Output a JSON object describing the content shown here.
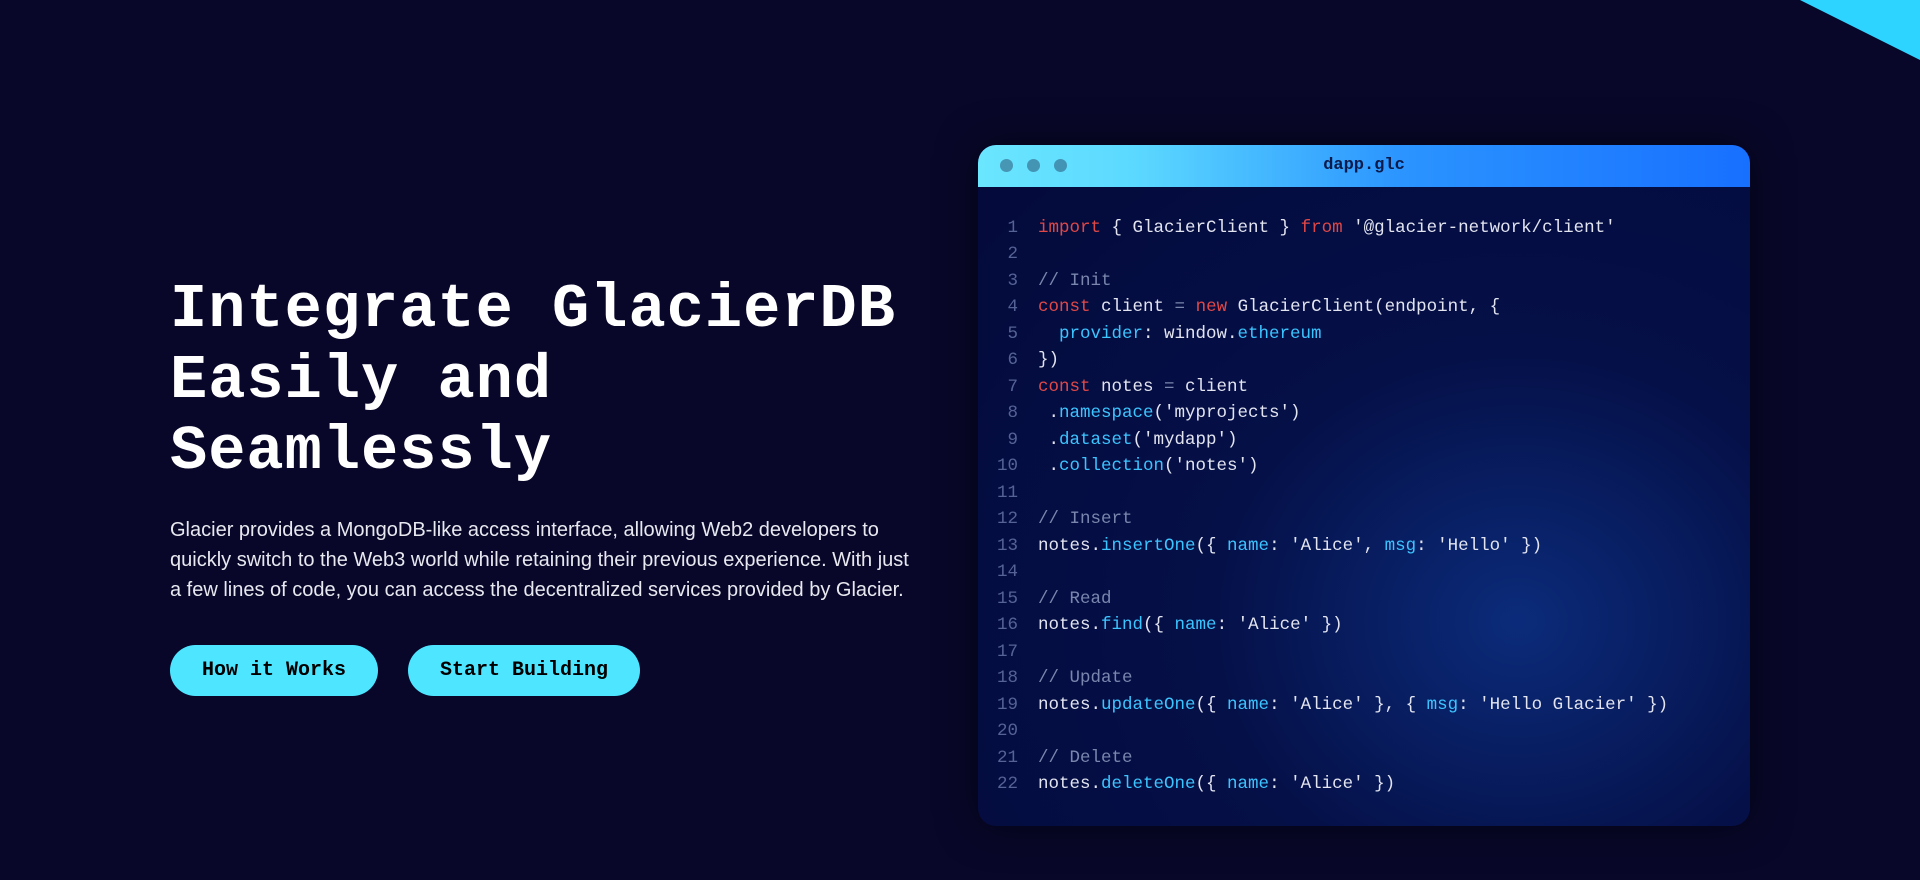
{
  "hero": {
    "heading": "Integrate GlacierDB\nEasily and Seamlessly",
    "description": "Glacier provides a MongoDB-like access interface, allowing Web2 developers to quickly switch to the Web3 world while retaining their previous experience. With just a few lines of code, you can access the decentralized services provided by Glacier.",
    "buttons": {
      "how": "How it Works",
      "start": "Start Building"
    }
  },
  "editor": {
    "filename": "dapp.glc",
    "lines": [
      [
        {
          "t": "key",
          "v": "import"
        },
        {
          "t": "",
          "v": " { GlacierClient } "
        },
        {
          "t": "key",
          "v": "from"
        },
        {
          "t": "",
          "v": " '@glacier-network/client'"
        }
      ],
      [],
      [
        {
          "t": "com",
          "v": "// Init"
        }
      ],
      [
        {
          "t": "key",
          "v": "const"
        },
        {
          "t": "",
          "v": " client "
        },
        {
          "t": "com",
          "v": "="
        },
        {
          "t": "",
          "v": " "
        },
        {
          "t": "key",
          "v": "new"
        },
        {
          "t": "",
          "v": " GlacierClient(endpoint, {"
        }
      ],
      [
        {
          "t": "",
          "v": "  "
        },
        {
          "t": "prop",
          "v": "provider"
        },
        {
          "t": "",
          "v": ": window."
        },
        {
          "t": "prop",
          "v": "ethereum"
        }
      ],
      [
        {
          "t": "",
          "v": "})"
        }
      ],
      [
        {
          "t": "key",
          "v": "const"
        },
        {
          "t": "",
          "v": " notes "
        },
        {
          "t": "com",
          "v": "="
        },
        {
          "t": "",
          "v": " client"
        }
      ],
      [
        {
          "t": "",
          "v": " ."
        },
        {
          "t": "func",
          "v": "namespace"
        },
        {
          "t": "",
          "v": "('myprojects')"
        }
      ],
      [
        {
          "t": "",
          "v": " ."
        },
        {
          "t": "func",
          "v": "dataset"
        },
        {
          "t": "",
          "v": "('mydapp')"
        }
      ],
      [
        {
          "t": "",
          "v": " ."
        },
        {
          "t": "func",
          "v": "collection"
        },
        {
          "t": "",
          "v": "('notes')"
        }
      ],
      [],
      [
        {
          "t": "com",
          "v": "// Insert"
        }
      ],
      [
        {
          "t": "",
          "v": "notes."
        },
        {
          "t": "func",
          "v": "insertOne"
        },
        {
          "t": "",
          "v": "({ "
        },
        {
          "t": "prop",
          "v": "name"
        },
        {
          "t": "",
          "v": ": 'Alice', "
        },
        {
          "t": "prop",
          "v": "msg"
        },
        {
          "t": "",
          "v": ": 'Hello' })"
        }
      ],
      [],
      [
        {
          "t": "com",
          "v": "// Read"
        }
      ],
      [
        {
          "t": "",
          "v": "notes."
        },
        {
          "t": "func",
          "v": "find"
        },
        {
          "t": "",
          "v": "({ "
        },
        {
          "t": "prop",
          "v": "name"
        },
        {
          "t": "",
          "v": ": 'Alice' })"
        }
      ],
      [],
      [
        {
          "t": "com",
          "v": "// Update"
        }
      ],
      [
        {
          "t": "",
          "v": "notes."
        },
        {
          "t": "func",
          "v": "updateOne"
        },
        {
          "t": "",
          "v": "({ "
        },
        {
          "t": "prop",
          "v": "name"
        },
        {
          "t": "",
          "v": ": 'Alice' }, { "
        },
        {
          "t": "prop",
          "v": "msg"
        },
        {
          "t": "",
          "v": ": 'Hello Glacier' })"
        }
      ],
      [],
      [
        {
          "t": "com",
          "v": "// Delete"
        }
      ],
      [
        {
          "t": "",
          "v": "notes."
        },
        {
          "t": "func",
          "v": "deleteOne"
        },
        {
          "t": "",
          "v": "({ "
        },
        {
          "t": "prop",
          "v": "name"
        },
        {
          "t": "",
          "v": ": 'Alice' })"
        }
      ]
    ]
  }
}
